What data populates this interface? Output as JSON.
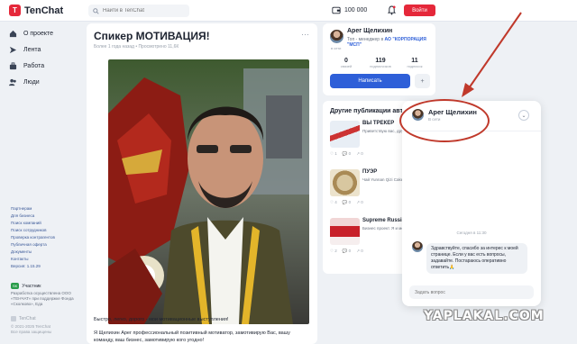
{
  "header": {
    "logo_text": "TenChat",
    "search_placeholder": "Найти в TenChat",
    "balance": "100 000",
    "login_label": "Войти"
  },
  "sidebar": {
    "items": [
      {
        "label": "О проекте",
        "icon": "home-icon"
      },
      {
        "label": "Лента",
        "icon": "feed-icon"
      },
      {
        "label": "Работа",
        "icon": "briefcase-icon"
      },
      {
        "label": "Люди",
        "icon": "people-icon"
      }
    ],
    "footer_links": [
      "Партнерам",
      "Для бизнеса",
      "Поиск компаний",
      "Поиск сотрудников",
      "Проверка контрагентов",
      "Публичная оферта",
      "Документы",
      "Контакты",
      "Версия: 1.15.29"
    ],
    "badge_code": "SK",
    "badge_label": "Участник",
    "company_text": "Разработка осуществлена ООО «ТЕНЧАТ» при поддержке Фонда «Сколково», Еда",
    "small_logo": "TenChat",
    "copyright": "© 2021-2025 TenChat\nВсе права защищены"
  },
  "post": {
    "title": "Спикер МОТИВАЦИЯ!",
    "meta": "Более 1 года назад • Просмотрено 11,6К",
    "text1": "Быстро, легко, дорого - мои мотивационные выступления!",
    "text2": "Я Щелихин Арег профессиональный позитивный мотиватор, замотивирую Вас, вашу команду, ваш бизнес, замотивирую кого угодно!"
  },
  "profile": {
    "name": "Арег Щелихин",
    "role_prefix": "Топ - менеджер в",
    "company": "АО \"КОРПОРАЦИЯ \"МСП\"",
    "status": "в сети",
    "stats": [
      {
        "num": "0",
        "label": "связей"
      },
      {
        "num": "119",
        "label": "подписчиков"
      },
      {
        "num": "11",
        "label": "подписок"
      }
    ],
    "write_label": "Написать"
  },
  "publications": {
    "title": "Другие публикации автора",
    "items": [
      {
        "title": "ВЫ ТРЕКЕР",
        "desc": "Приветствую вас, друзья! Приглашаю",
        "likes": "1",
        "comments": "0",
        "views": "0"
      },
      {
        "title": "ПУЭР",
        "desc": "Чай Yunnan Qizi Cake пуэр, приготовленный",
        "likes": "4",
        "comments": "0",
        "views": "0"
      },
      {
        "title": "Supreme Russia..",
        "desc": "Бизнес проект. Я и моя команда по бизнесу",
        "likes": "2",
        "comments": "0",
        "views": "0"
      }
    ]
  },
  "chat": {
    "name": "Арег Щелихин",
    "status": "В сети",
    "date": "Сегодня в 11:30",
    "message": "Здравствуйте, спасибо за интерес к моей странице. Если у вас есть вопросы, задавайте. Постараюсь оперативно ответить🙏",
    "input_placeholder": "Задать вопрос"
  },
  "watermark": "YAPLAKAL.COM",
  "colors": {
    "brand": "#e5283a",
    "accent": "#2e5fd8",
    "annotation": "#c0392b"
  }
}
